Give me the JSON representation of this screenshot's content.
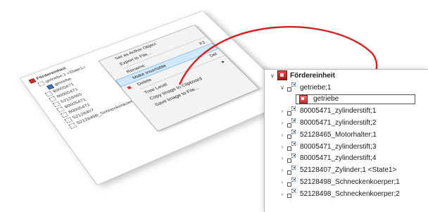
{
  "tilted_screenshot": {
    "tree": [
      {
        "icon": "assembly-icon",
        "label": "Fördereinheit"
      },
      {
        "icon": "subassembly-icon",
        "label": "getriebe;1 <State1>"
      },
      {
        "icon": "part-icon",
        "label": "getriebe"
      },
      {
        "icon": "subassembly-icon",
        "label": "80005471"
      },
      {
        "icon": "subassembly-icon",
        "label": "80005471"
      },
      {
        "icon": "subassembly-icon",
        "label": "52128465"
      },
      {
        "icon": "subassembly-icon",
        "label": "80005471"
      },
      {
        "icon": "subassembly-icon",
        "label": "80005471"
      },
      {
        "icon": "subassembly-icon",
        "label": "52128407"
      },
      {
        "icon": "subassembly-icon",
        "label": "52128498_Schneckenkoerper;2"
      }
    ],
    "context_menu": {
      "items": [
        {
          "label": "Set as Active Object",
          "accel": ""
        },
        {
          "label": "Export to File...",
          "accel": ""
        },
        {
          "label": "Rename",
          "accel": "F2"
        },
        {
          "label": "Make Insertable",
          "accel": "",
          "highlighted": true
        },
        {
          "label": "Delete",
          "accel": "Del",
          "icon": "delete-x-icon"
        },
        {
          "label": "Tree Level",
          "accel": "▸"
        },
        {
          "label": "Copy Image to Clipboard",
          "accel": ""
        },
        {
          "label": "Save Image to File...",
          "accel": ""
        }
      ]
    }
  },
  "zoomed_tree": {
    "root": {
      "label": "Fördereinheit",
      "icon": "assembly-icon",
      "expanded": true
    },
    "rows": [
      {
        "label": "getriebe;1",
        "icon": "subassembly-icon",
        "chevron": "expanded",
        "indent": 1
      },
      {
        "label": "getriebe",
        "icon": "part-icon",
        "chevron": "none",
        "indent": 2,
        "editing": true
      },
      {
        "label": "80005471_zylinderstift;1",
        "icon": "subassembly-icon",
        "chevron": "collapsed",
        "indent": 1
      },
      {
        "label": "80005471_zylinderstift;2",
        "icon": "subassembly-icon",
        "chevron": "collapsed",
        "indent": 1
      },
      {
        "label": "52128465_Motorhalter;1",
        "icon": "subassembly-icon",
        "chevron": "collapsed",
        "indent": 1
      },
      {
        "label": "80005471_zylinderstift;3",
        "icon": "subassembly-icon",
        "chevron": "collapsed",
        "indent": 1
      },
      {
        "label": "80005471_zylinderstift;4",
        "icon": "subassembly-icon",
        "chevron": "collapsed",
        "indent": 1
      },
      {
        "label": "52128407_Zylinder;1 <State1>",
        "icon": "subassembly-icon",
        "chevron": "collapsed",
        "indent": 1
      },
      {
        "label": "52128498_Schneckenkoerper;1",
        "icon": "subassembly-icon",
        "chevron": "collapsed",
        "indent": 1
      },
      {
        "label": "52128498_Schneckenkoerper;2",
        "icon": "subassembly-icon",
        "chevron": "collapsed",
        "indent": 1
      }
    ]
  },
  "colors": {
    "arrow": "#d42020",
    "selection": "#cfe8fb"
  }
}
